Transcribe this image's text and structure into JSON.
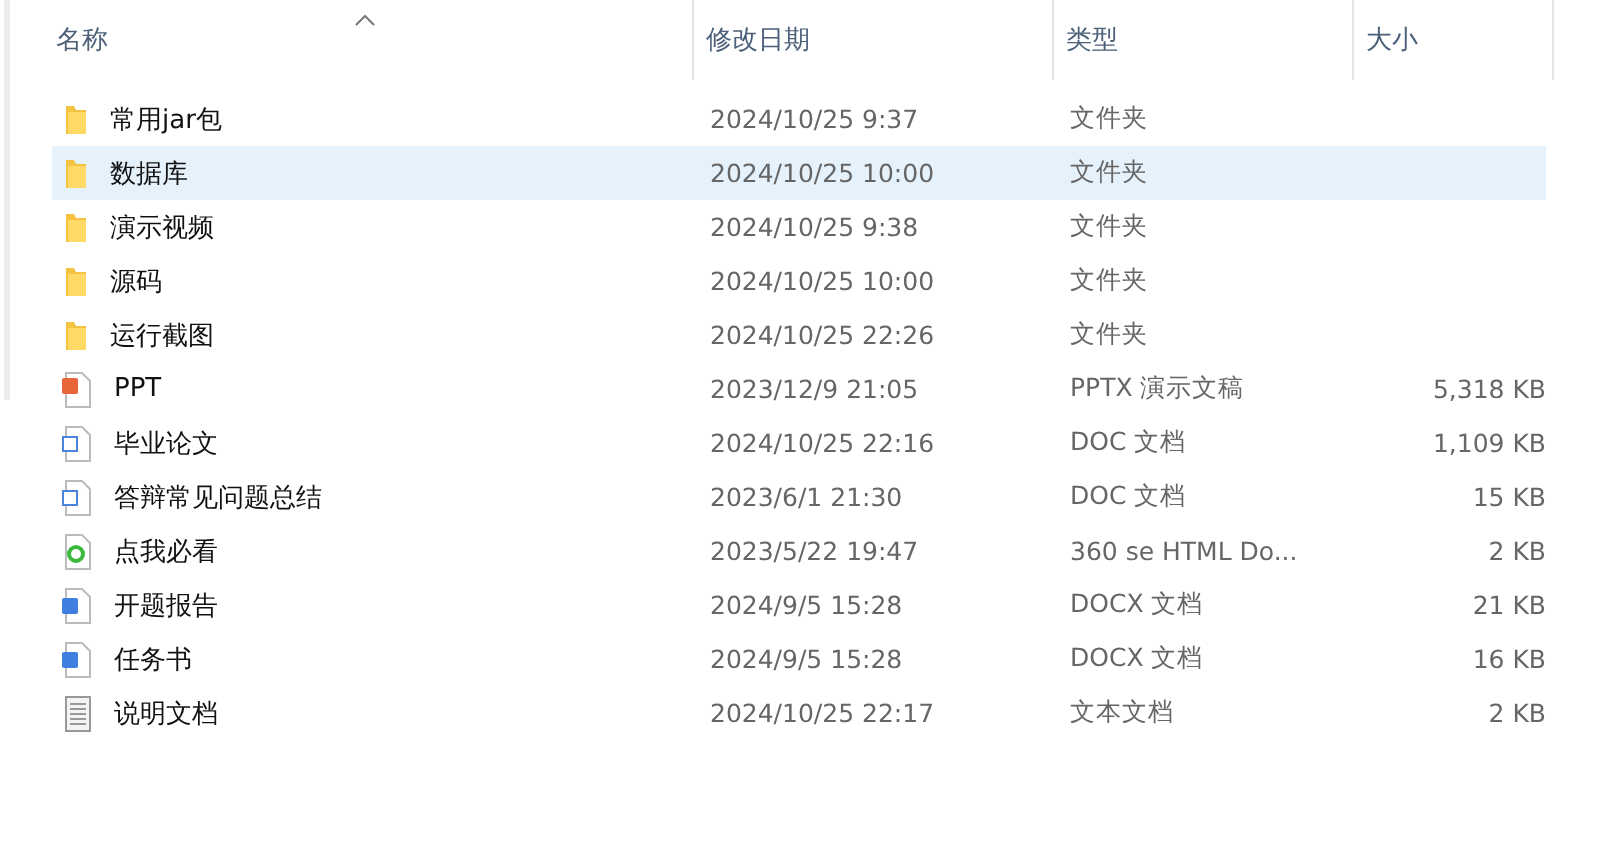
{
  "columns": [
    {
      "label": "名称",
      "sorted": true
    },
    {
      "label": "修改日期",
      "sorted": false
    },
    {
      "label": "类型",
      "sorted": false
    },
    {
      "label": "大小",
      "sorted": false
    }
  ],
  "rows": [
    {
      "kind": "folder",
      "name": "常用jar包",
      "date": "2024/10/25 9:37",
      "type": "文件夹",
      "selected": false
    },
    {
      "kind": "folder",
      "name": "数据库",
      "date": "2024/10/25 10:00",
      "type": "文件夹",
      "selected": true
    },
    {
      "kind": "folder",
      "name": "演示视频",
      "date": "2024/10/25 9:38",
      "type": "文件夹",
      "selected": false
    },
    {
      "kind": "folder",
      "name": "源码",
      "date": "2024/10/25 10:00",
      "type": "文件夹",
      "selected": false
    },
    {
      "kind": "folder",
      "name": "运行截图",
      "date": "2024/10/25 22:26",
      "type": "文件夹",
      "selected": false
    },
    {
      "kind": "ppt",
      "name": "PPT",
      "date": "2023/12/9 21:05",
      "type": "PPTX 演示文稿",
      "size": "5,318 KB",
      "selected": false
    },
    {
      "kind": "doc",
      "name": "毕业论文",
      "date": "2024/10/25 22:16",
      "type": "DOC 文档",
      "size": "1,109 KB",
      "selected": false
    },
    {
      "kind": "doc",
      "name": "答辩常见问题总结",
      "date": "2023/6/1 21:30",
      "type": "DOC 文档",
      "size": "15 KB",
      "selected": false
    },
    {
      "kind": "html",
      "name": "点我必看",
      "date": "2023/5/22 19:47",
      "type": "360 se HTML Do...",
      "size": "2 KB",
      "selected": false
    },
    {
      "kind": "docx",
      "name": "开题报告",
      "date": "2024/9/5 15:28",
      "type": "DOCX 文档",
      "size": "21 KB",
      "selected": false
    },
    {
      "kind": "docx",
      "name": "任务书",
      "date": "2024/9/5 15:28",
      "type": "DOCX 文档",
      "size": "16 KB",
      "selected": false
    },
    {
      "kind": "txt",
      "name": "说明文档",
      "date": "2024/10/25 22:17",
      "type": "文本文档",
      "size": "2 KB",
      "selected": false
    }
  ]
}
